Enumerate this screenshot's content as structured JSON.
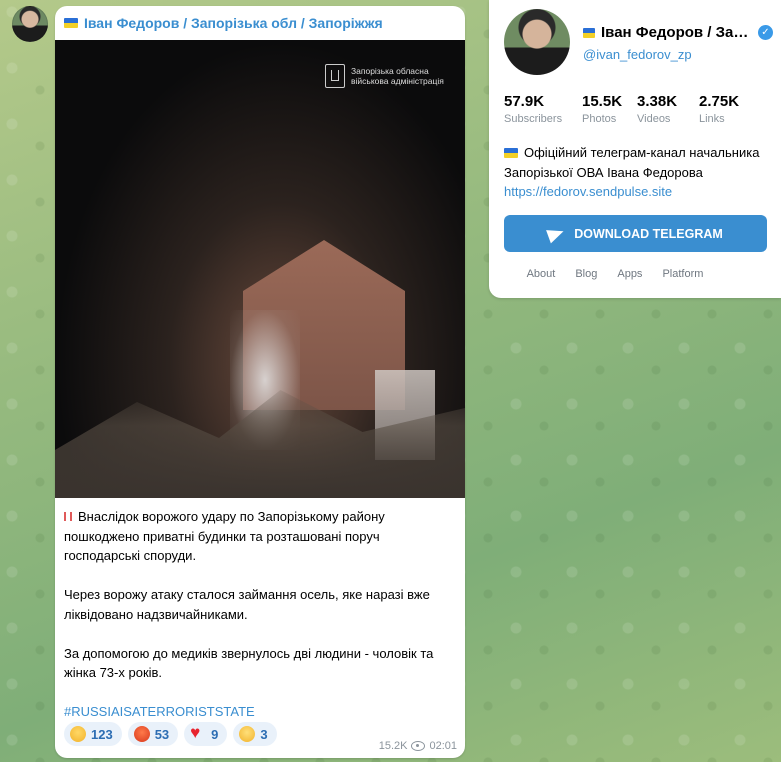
{
  "post": {
    "channel_title": "Іван Федоров / Запорізька обл / Запоріжжя",
    "photo_watermark_line1": "Запорізька обласна",
    "photo_watermark_line2": "військова адміністрація",
    "paragraphs": [
      "Внаслідок ворожого удару по Запорізькому району пошкоджено приватні будинки та розташовані поруч господарські споруди.",
      "Через ворожу атаку сталося займання осель, яке наразі вже ліквідовано надзвичайниками.",
      "За допомогою до медиків звернулось дві людини - чоловік та жінка 73-х років."
    ],
    "hashtag": "#RUSSIAISATERRORISTSTATE",
    "reactions": [
      {
        "emoji": "crying-face",
        "count": "123"
      },
      {
        "emoji": "angry-face",
        "count": "53"
      },
      {
        "emoji": "red-heart",
        "count": "9"
      },
      {
        "emoji": "thinking-face",
        "count": "3"
      }
    ],
    "views": "15.2K",
    "time": "02:01"
  },
  "channel": {
    "name": "Іван Федоров / Запорізька обл / Запоріжжя",
    "handle": "@ivan_fedorov_zp",
    "stats": [
      {
        "value": "57.9K",
        "label": "Subscribers"
      },
      {
        "value": "15.5K",
        "label": "Photos"
      },
      {
        "value": "3.38K",
        "label": "Videos"
      },
      {
        "value": "2.75K",
        "label": "Links"
      }
    ],
    "description": "Офіційний телеграм-канал начальника Запорізької ОВА Івана Федорова",
    "link": "https://fedorov.sendpulse.site",
    "download_label": "DOWNLOAD TELEGRAM",
    "footer_links": [
      "About",
      "Blog",
      "Apps",
      "Platform"
    ],
    "accent_color": "#3a8ed0"
  }
}
